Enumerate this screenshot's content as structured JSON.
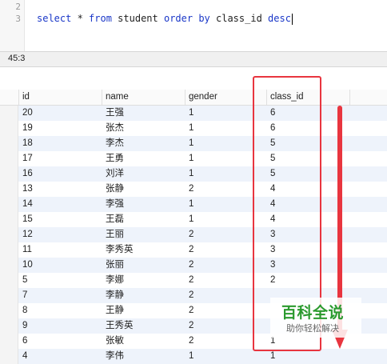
{
  "editor": {
    "line_numbers": [
      "2",
      "3"
    ],
    "query_keywords": [
      "select",
      "from",
      "order by",
      "desc"
    ],
    "query_text": "select * from student order by class_id desc"
  },
  "status": {
    "cursor_position": "45:3"
  },
  "grid": {
    "columns": [
      "id",
      "name",
      "gender",
      "class_id"
    ],
    "rows": [
      [
        "20",
        "王强",
        "1",
        "6"
      ],
      [
        "19",
        "张杰",
        "1",
        "6"
      ],
      [
        "18",
        "李杰",
        "1",
        "5"
      ],
      [
        "17",
        "王勇",
        "1",
        "5"
      ],
      [
        "16",
        "刘洋",
        "1",
        "5"
      ],
      [
        "13",
        "张静",
        "2",
        "4"
      ],
      [
        "14",
        "李强",
        "1",
        "4"
      ],
      [
        "15",
        "王磊",
        "1",
        "4"
      ],
      [
        "12",
        "王丽",
        "2",
        "3"
      ],
      [
        "11",
        "李秀英",
        "2",
        "3"
      ],
      [
        "10",
        "张丽",
        "2",
        "3"
      ],
      [
        "5",
        "李娜",
        "2",
        "2"
      ],
      [
        "7",
        "李静",
        "2",
        ""
      ],
      [
        "8",
        "王静",
        "2",
        ""
      ],
      [
        "9",
        "王秀英",
        "2",
        ""
      ],
      [
        "6",
        "张敏",
        "2",
        "1"
      ],
      [
        "4",
        "李伟",
        "1",
        "1"
      ]
    ]
  },
  "watermark": {
    "brand": "百科全说",
    "tagline": "助你轻松解决"
  },
  "colors": {
    "annotation_red": "#e8353f",
    "keyword_blue": "#1a37c8",
    "watermark_green": "#2a9a2e"
  }
}
